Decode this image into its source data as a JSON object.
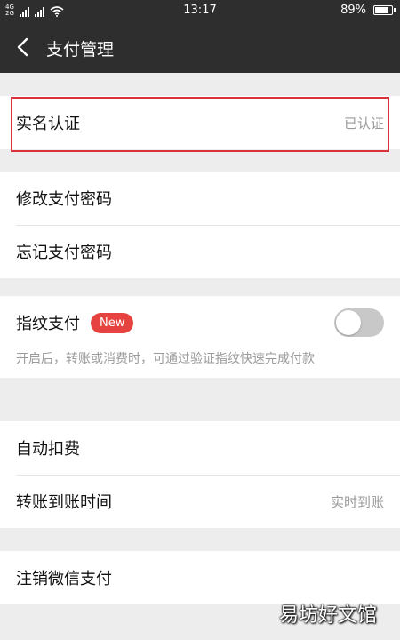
{
  "status_bar": {
    "network_top": "4G",
    "network_bottom": "2G",
    "time": "13:17",
    "battery": "89%",
    "battery_level": 0.89
  },
  "nav": {
    "back_icon": "chevron-left-icon",
    "title": "支付管理"
  },
  "sections": {
    "realname": {
      "label": "实名认证",
      "value": "已认证"
    },
    "change_password": {
      "label": "修改支付密码"
    },
    "forgot_password": {
      "label": "忘记支付密码"
    },
    "fingerprint": {
      "label": "指纹支付",
      "badge": "New",
      "toggle_on": false,
      "description": "开启后，转账或消费时，可通过验证指纹快速完成付款"
    },
    "auto_deduct": {
      "label": "自动扣费"
    },
    "transfer_time": {
      "label": "转账到账时间",
      "value": "实时到账"
    },
    "cancel_wechat_pay": {
      "label": "注销微信支付"
    }
  },
  "watermark": "易坊好文馆",
  "colors": {
    "header_bg": "#2e2e2e",
    "page_bg": "#ededed",
    "badge_bg": "#e64340",
    "highlight_border": "#d9323a"
  }
}
